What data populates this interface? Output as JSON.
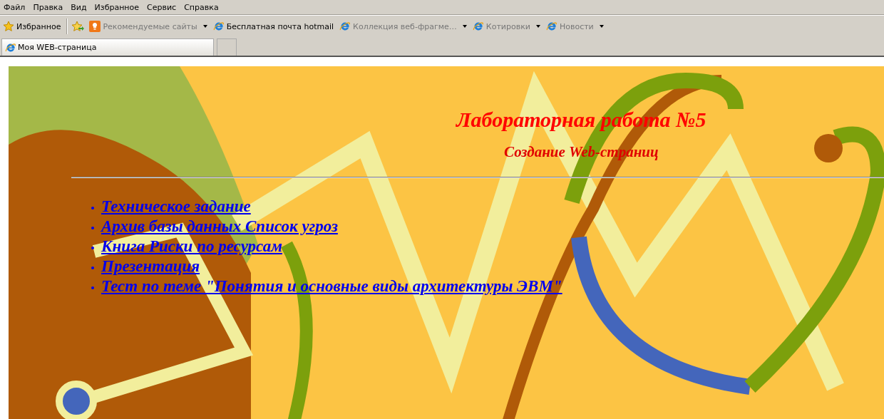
{
  "menu": [
    "Файл",
    "Правка",
    "Вид",
    "Избранное",
    "Сервис",
    "Справка"
  ],
  "favorites_bar": {
    "favorites_button": "Избранное",
    "items": [
      {
        "label": "Рекомендуемые сайты",
        "kind": "dropdown",
        "disabled": true
      },
      {
        "label": "Бесплатная почта hotmail",
        "kind": "link",
        "disabled": false
      },
      {
        "label": "Коллекция веб-фрагме…",
        "kind": "dropdown",
        "disabled": true
      },
      {
        "label": "Котировки",
        "kind": "dropdown",
        "disabled": true
      },
      {
        "label": "Новости",
        "kind": "dropdown",
        "disabled": true
      }
    ]
  },
  "tabs": [
    {
      "label": "Моя WEB-страница",
      "selected": true
    }
  ],
  "page": {
    "title": "Лабораторная работа №5",
    "subtitle": "Создание Web-страниц",
    "links": [
      "Техническое задание",
      "Архив базы данных Список угроз",
      "Книга Риски по ресурсам",
      "Презентация",
      "Тест по теме \"Понятия и основные виды архитектуры ЭВМ\""
    ]
  }
}
